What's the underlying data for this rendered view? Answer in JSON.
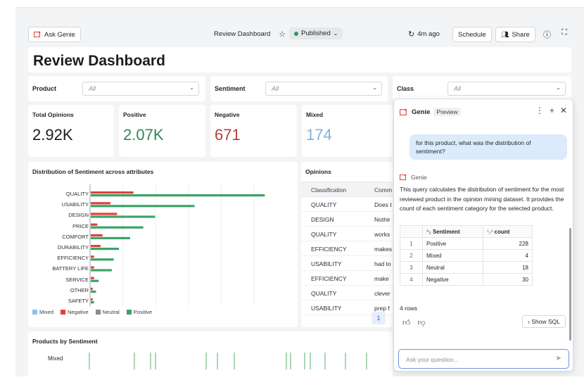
{
  "topbar": {
    "ask_genie": "Ask Genie",
    "dashboard_name": "Review Dashboard",
    "status": "Published",
    "refresh": "4m ago",
    "schedule": "Schedule",
    "share": "Share"
  },
  "page_title": "Review Dashboard",
  "filters": [
    {
      "label": "Product",
      "value": "All"
    },
    {
      "label": "Sentiment",
      "value": "All"
    },
    {
      "label": "Class",
      "value": "All"
    }
  ],
  "kpis": [
    {
      "label": "Total Opinions",
      "value": "2.92K",
      "color": "#1b1d21"
    },
    {
      "label": "Positive",
      "value": "2.07K",
      "color": "#2f8a5a"
    },
    {
      "label": "Negative",
      "value": "671",
      "color": "#b2413c"
    },
    {
      "label": "Mixed",
      "value": "174",
      "color": "#7fb2e0"
    }
  ],
  "distribution": {
    "title": "Distribution of Sentiment across attributes",
    "legend": [
      {
        "name": "Mixed",
        "color": "#8fc0e6"
      },
      {
        "name": "Negative",
        "color": "#e0413a"
      },
      {
        "name": "Neutral",
        "color": "#8c8c8c"
      },
      {
        "name": "Positive",
        "color": "#3aa36a"
      }
    ]
  },
  "chart_data": {
    "type": "bar",
    "orientation": "horizontal",
    "categories": [
      "QUALITY",
      "USABILITY",
      "DESIGN",
      "PRICE",
      "COMFORT",
      "DURABILITY",
      "EFFICIENCY",
      "BATTERY LIFE",
      "SERVICE",
      "OTHER",
      "SAFETY"
    ],
    "series": [
      {
        "name": "Negative",
        "values": [
          65,
          30,
          40,
          10,
          18,
          15,
          5,
          5,
          5,
          3,
          3
        ]
      },
      {
        "name": "Positive",
        "values": [
          265,
          158,
          98,
          80,
          60,
          43,
          35,
          32,
          12,
          8,
          5
        ]
      }
    ],
    "legend_position": "bottom-left"
  },
  "opinions": {
    "title": "Opinions",
    "headers": [
      "Classification",
      "Comm"
    ],
    "rows": [
      [
        "QUALITY",
        "Does t"
      ],
      [
        "DESIGN",
        "Nothir"
      ],
      [
        "QUALITY",
        "works"
      ],
      [
        "EFFICIENCY",
        "makes"
      ],
      [
        "USABILITY",
        "had to"
      ],
      [
        "EFFICIENCY",
        "make"
      ],
      [
        "QUALITY",
        "clever"
      ],
      [
        "USABILITY",
        "prep f"
      ]
    ],
    "page": "1"
  },
  "products": {
    "title": "Products by Sentiment",
    "row_label": "Mixed"
  },
  "genie": {
    "title": "Genie",
    "badge": "Preview",
    "question": "for this product, what was the distribution of sentiment?",
    "responder": "Genie",
    "answer": "This query calculates the distribution of sentiment for the most reviewed product in the opinion mining dataset. It provides the count of each sentiment category for the selected product.",
    "table_headers": [
      "Sentiment",
      "count"
    ],
    "table_rows": [
      [
        "1",
        "Positive",
        "228"
      ],
      [
        "2",
        "Mixed",
        "4"
      ],
      [
        "3",
        "Neutral",
        "18"
      ],
      [
        "4",
        "Negative",
        "30"
      ]
    ],
    "rows_count": "4 rows",
    "show_sql": "Show SQL",
    "placeholder": "Ask your question..."
  }
}
